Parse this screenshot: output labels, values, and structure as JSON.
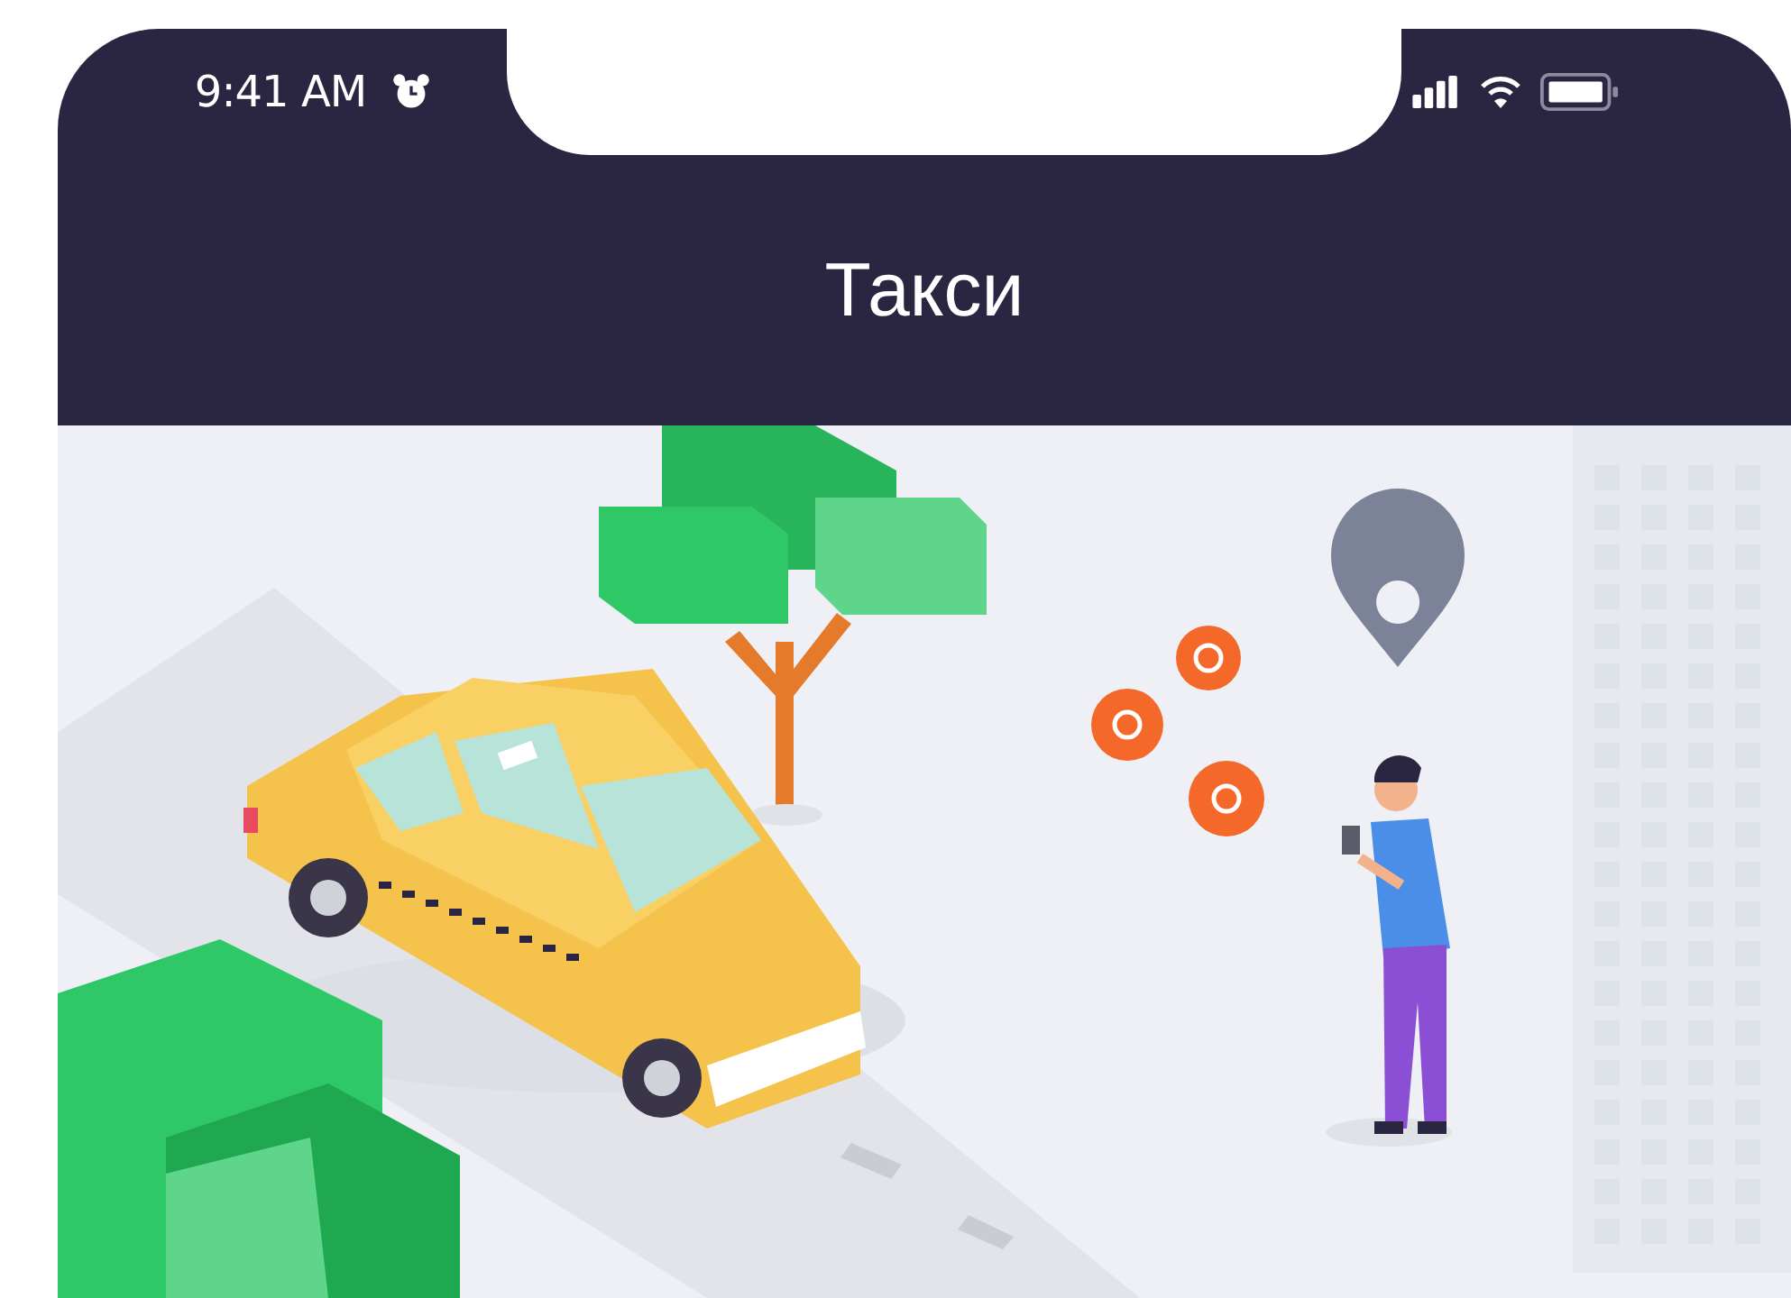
{
  "status_bar": {
    "time": "9:41 AM"
  },
  "header": {
    "title": "Такси"
  }
}
